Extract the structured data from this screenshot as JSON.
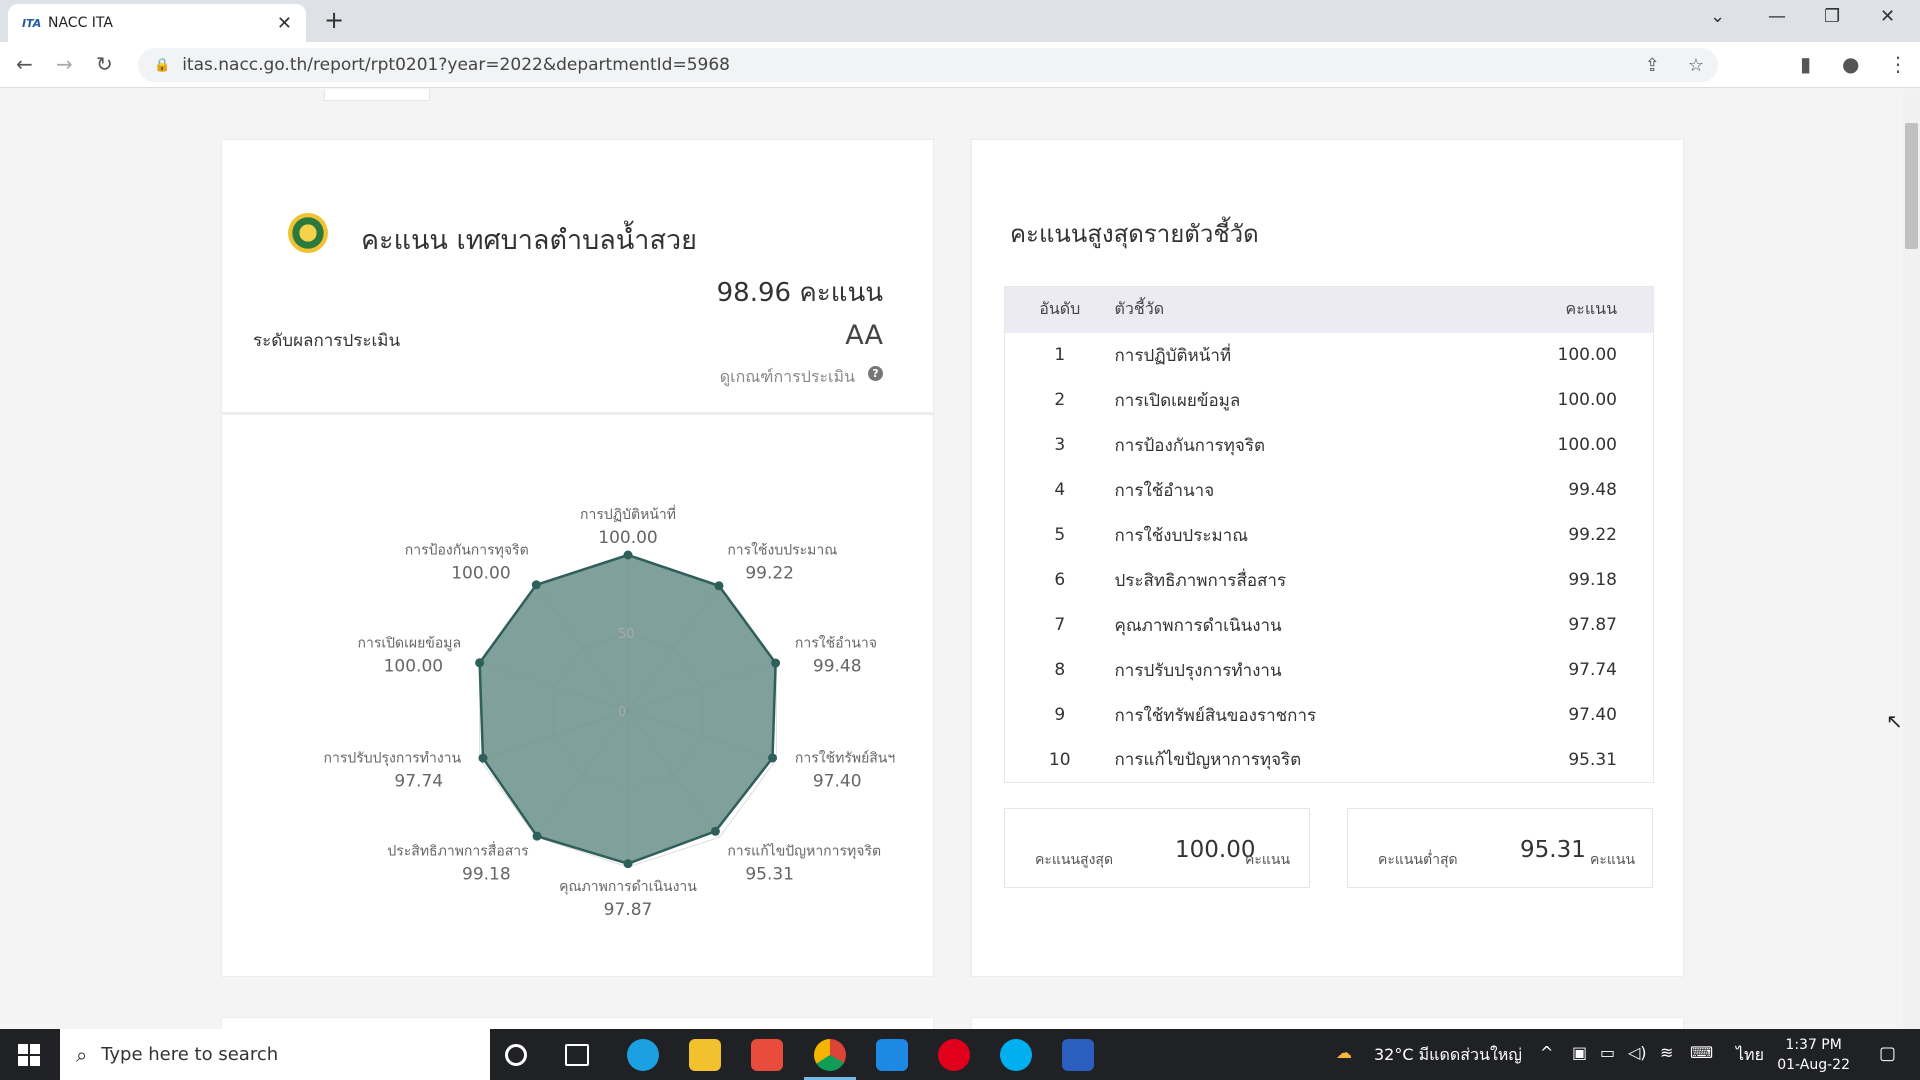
{
  "browser": {
    "tab_title": "NACC ITA",
    "favicon_text": "ITA",
    "url": "itas.nacc.go.th/report/rpt0201?year=2022&departmentId=5968"
  },
  "score_card": {
    "title": "คะแนน เทศบาลตำบลน้ำสวย",
    "score": "98.96 คะแนน",
    "grade_label": "ระดับผลการประเมิน",
    "grade": "AA",
    "criteria_link": "ดูเกณฑ์การประเมิน"
  },
  "chart_data": {
    "type": "radar",
    "ticks": [
      "0",
      "50"
    ],
    "rmax": 100,
    "axes": [
      {
        "label": "การปฏิบัติหน้าที่",
        "value": "100.00"
      },
      {
        "label": "การใช้งบประมาณ",
        "value": "99.22"
      },
      {
        "label": "การใช้อำนาจ",
        "value": "99.48"
      },
      {
        "label": "การใช้ทรัพย์สินฯ",
        "value": "97.40"
      },
      {
        "label": "การแก้ไขปัญหาการทุจริต",
        "value": "95.31"
      },
      {
        "label": "คุณภาพการดำเนินงาน",
        "value": "97.87"
      },
      {
        "label": "ประสิทธิภาพการสื่อสาร",
        "value": "99.18"
      },
      {
        "label": "การปรับปรุงการทำงาน",
        "value": "97.74"
      },
      {
        "label": "การเปิดเผยข้อมูล",
        "value": "100.00"
      },
      {
        "label": "การป้องกันการทุจริต",
        "value": "100.00"
      }
    ],
    "fill_color": "#6a8f8b",
    "line_color": "#2f5f5a"
  },
  "ranking": {
    "title": "คะแนนสูงสุดรายตัวชี้วัด",
    "headers": {
      "rank": "อันดับ",
      "indicator": "ตัวชี้วัด",
      "score": "คะแนน"
    },
    "rows": [
      {
        "rank": "1",
        "indicator": "การปฏิบัติหน้าที่",
        "score": "100.00"
      },
      {
        "rank": "2",
        "indicator": "การเปิดเผยข้อมูล",
        "score": "100.00"
      },
      {
        "rank": "3",
        "indicator": "การป้องกันการทุจริต",
        "score": "100.00"
      },
      {
        "rank": "4",
        "indicator": "การใช้อำนาจ",
        "score": "99.48"
      },
      {
        "rank": "5",
        "indicator": "การใช้งบประมาณ",
        "score": "99.22"
      },
      {
        "rank": "6",
        "indicator": "ประสิทธิภาพการสื่อสาร",
        "score": "99.18"
      },
      {
        "rank": "7",
        "indicator": "คุณภาพการดำเนินงาน",
        "score": "97.87"
      },
      {
        "rank": "8",
        "indicator": "การปรับปรุงการทำงาน",
        "score": "97.74"
      },
      {
        "rank": "9",
        "indicator": "การใช้ทรัพย์สินของราชการ",
        "score": "97.40"
      },
      {
        "rank": "10",
        "indicator": "การแก้ไขปัญหาการทุจริต",
        "score": "95.31"
      }
    ],
    "max_label": "คะแนนสูงสุด",
    "max_value": "100.00",
    "min_label": "คะแนนต่ำสุด",
    "min_value": "95.31",
    "unit": "คะแนน"
  },
  "taskbar": {
    "search_placeholder": "Type here to search",
    "weather": "32°C มีแดดส่วนใหญ่",
    "lang": "ไทย",
    "time": "1:37 PM",
    "date": "01-Aug-22"
  }
}
